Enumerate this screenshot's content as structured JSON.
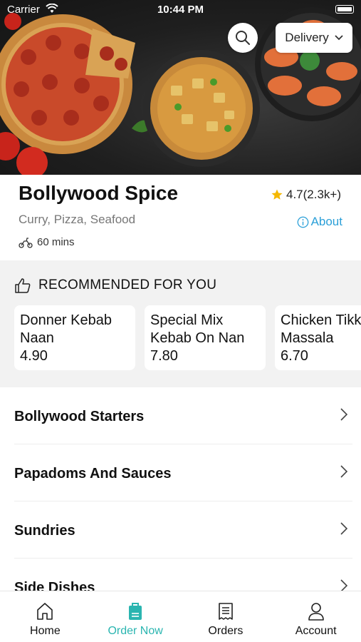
{
  "status_bar": {
    "carrier": "Carrier",
    "time": "10:44 PM"
  },
  "header": {
    "delivery_label": "Delivery"
  },
  "restaurant": {
    "name": "Bollywood Spice",
    "rating": "4.7(2.3k+)",
    "cuisines": "Curry, Pizza, Seafood",
    "about_label": "About",
    "delivery_time": "60 mins"
  },
  "recommended": {
    "title": "RECOMMENDED FOR YOU",
    "items": [
      {
        "name": "Donner Kebab\nNaan",
        "price": "4.90"
      },
      {
        "name": "Special Mix\nKebab On Nan",
        "price": "7.80"
      },
      {
        "name": "Chicken Tikka\nMassala",
        "price": "6.70"
      }
    ]
  },
  "categories": [
    "Bollywood Starters",
    "Papadoms And Sauces",
    "Sundries",
    "Side Dishes"
  ],
  "tabs": [
    {
      "label": "Home",
      "icon": "home-icon"
    },
    {
      "label": "Order Now",
      "icon": "order-bag-icon"
    },
    {
      "label": "Orders",
      "icon": "receipt-icon"
    },
    {
      "label": "Account",
      "icon": "person-icon"
    }
  ],
  "colors": {
    "accent": "#2ab5b0",
    "link": "#2a9fd8",
    "star": "#f5b800"
  }
}
